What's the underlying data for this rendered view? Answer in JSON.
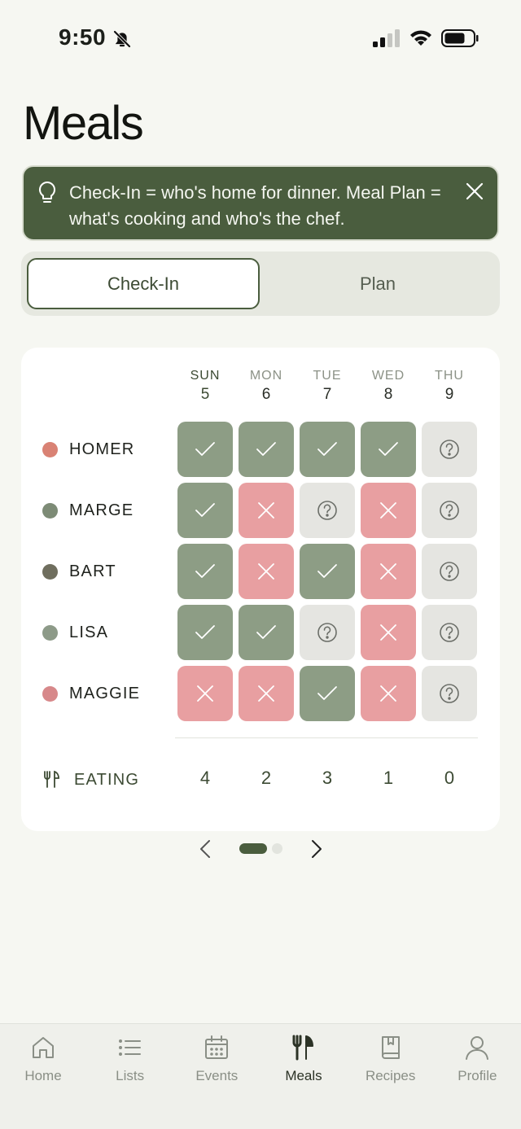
{
  "status_bar": {
    "time": "9:50"
  },
  "title": "Meals",
  "tip": {
    "text": "Check-In = who's home for dinner. Meal Plan = what's cooking and who's the chef."
  },
  "segments": {
    "checkin": "Check-In",
    "plan": "Plan",
    "selected": "Check-In"
  },
  "days": [
    {
      "name": "SUN",
      "num": "5",
      "active": true
    },
    {
      "name": "MON",
      "num": "6",
      "active": false
    },
    {
      "name": "TUE",
      "num": "7",
      "active": false
    },
    {
      "name": "WED",
      "num": "8",
      "active": false
    },
    {
      "name": "THU",
      "num": "9",
      "active": false
    }
  ],
  "people": [
    {
      "name": "HOMER",
      "color": "#d98274",
      "status": [
        "yes",
        "yes",
        "yes",
        "yes",
        "unknown"
      ]
    },
    {
      "name": "MARGE",
      "color": "#7d8b76",
      "status": [
        "yes",
        "no",
        "unknown",
        "no",
        "unknown"
      ]
    },
    {
      "name": "BART",
      "color": "#6f6e5e",
      "status": [
        "yes",
        "no",
        "yes",
        "no",
        "unknown"
      ]
    },
    {
      "name": "LISA",
      "color": "#8d9a88",
      "status": [
        "yes",
        "yes",
        "unknown",
        "no",
        "unknown"
      ]
    },
    {
      "name": "MAGGIE",
      "color": "#d7888a",
      "status": [
        "no",
        "no",
        "yes",
        "no",
        "unknown"
      ]
    }
  ],
  "eating": {
    "label": "EATING",
    "totals": [
      "4",
      "2",
      "3",
      "1",
      "0"
    ]
  },
  "pager": {
    "pages": 2,
    "current": 1
  },
  "tabs": [
    {
      "label": "Home",
      "icon": "home-icon",
      "active": false
    },
    {
      "label": "Lists",
      "icon": "list-icon",
      "active": false
    },
    {
      "label": "Events",
      "icon": "calendar-icon",
      "active": false
    },
    {
      "label": "Meals",
      "icon": "utensils-icon",
      "active": true
    },
    {
      "label": "Recipes",
      "icon": "book-icon",
      "active": false
    },
    {
      "label": "Profile",
      "icon": "user-icon",
      "active": false
    }
  ],
  "colors": {
    "accent": "#4a5d3e",
    "yes": "#8d9d85",
    "no": "#e89fa1",
    "unknown": "#e5e5e1"
  }
}
